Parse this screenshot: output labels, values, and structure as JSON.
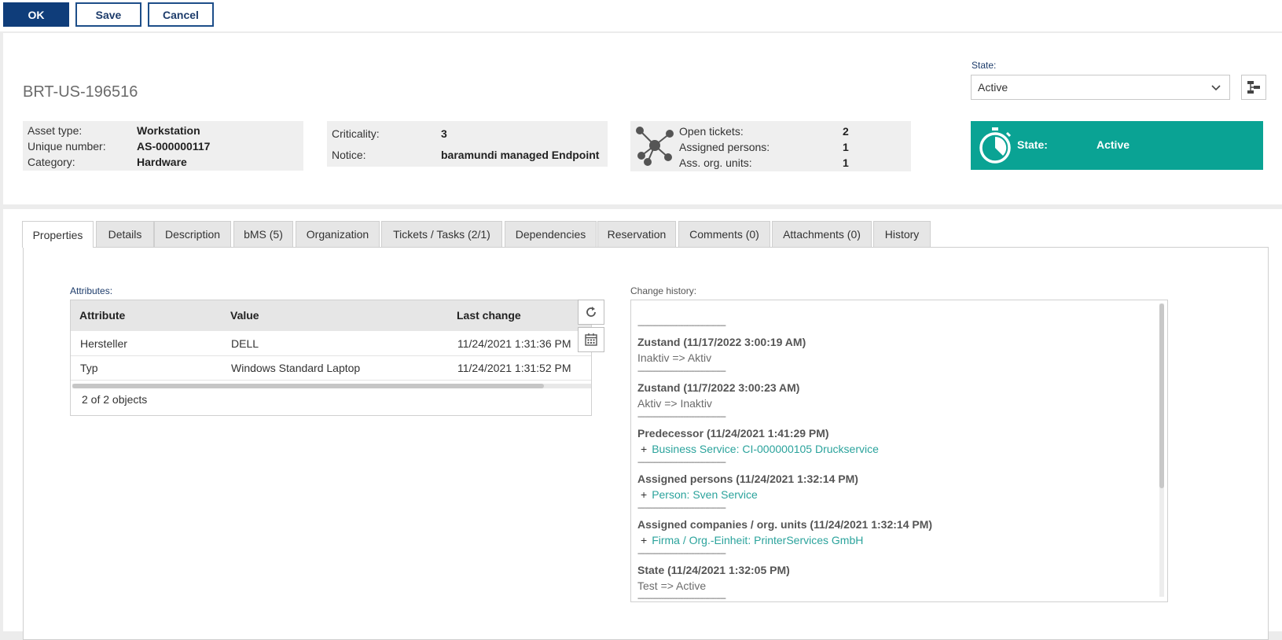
{
  "toolbar": {
    "ok": "OK",
    "save": "Save",
    "cancel": "Cancel"
  },
  "header": {
    "title": "BRT-US-196516",
    "state_label": "State:",
    "state_value": "Active",
    "box1": {
      "asset_type_k": "Asset type:",
      "asset_type_v": "Workstation",
      "unique_k": "Unique number:",
      "unique_v": "AS-000000117",
      "category_k": "Category:",
      "category_v": "Hardware"
    },
    "box2": {
      "criticality_k": "Criticality:",
      "criticality_v": "3",
      "notice_k": "Notice:",
      "notice_v": "baramundi managed Endpoint"
    },
    "box3": {
      "open_k": "Open tickets:",
      "open_v": "2",
      "persons_k": "Assigned persons:",
      "persons_v": "1",
      "org_k": "Ass. org. units:",
      "org_v": "1"
    },
    "tile": {
      "label": "State:",
      "value": "Active",
      "color": "#0aa394"
    }
  },
  "tabs": [
    "Properties",
    "Details",
    "Description",
    "bMS (5)",
    "Organization",
    "Tickets / Tasks (2/1)",
    "Dependencies",
    "Reservation",
    "Comments (0)",
    "Attachments (0)",
    "History"
  ],
  "attributes": {
    "label": "Attributes:",
    "columns": [
      "Attribute",
      "Value",
      "Last change"
    ],
    "rows": [
      [
        "Hersteller",
        "DELL",
        "11/24/2021 1:31:36 PM"
      ],
      [
        "Typ",
        "Windows Standard Laptop",
        "11/24/2021 1:31:52 PM"
      ]
    ],
    "footer": "2 of 2 objects"
  },
  "history": {
    "label": "Change history:",
    "separator": "------------------------------------------------",
    "entries": [
      {
        "title": "Zustand (11/17/2022 3:00:19 AM)",
        "text": "Inaktiv => Aktiv"
      },
      {
        "title": "Zustand (11/7/2022 3:00:23 AM)",
        "text": "Aktiv => Inaktiv"
      },
      {
        "title": "Predecessor (11/24/2021 1:41:29 PM)",
        "plus": "+",
        "link": "Business Service: CI-000000105 Druckservice"
      },
      {
        "title": "Assigned persons (11/24/2021 1:32:14 PM)",
        "plus": "+",
        "link": "Person: Sven Service"
      },
      {
        "title": "Assigned companies / org. units (11/24/2021 1:32:14 PM)",
        "plus": "+",
        "link": "Firma / Org.-Einheit: PrinterServices GmbH"
      },
      {
        "title": "State (11/24/2021 1:32:05 PM)",
        "text": "Test => Active"
      }
    ]
  }
}
